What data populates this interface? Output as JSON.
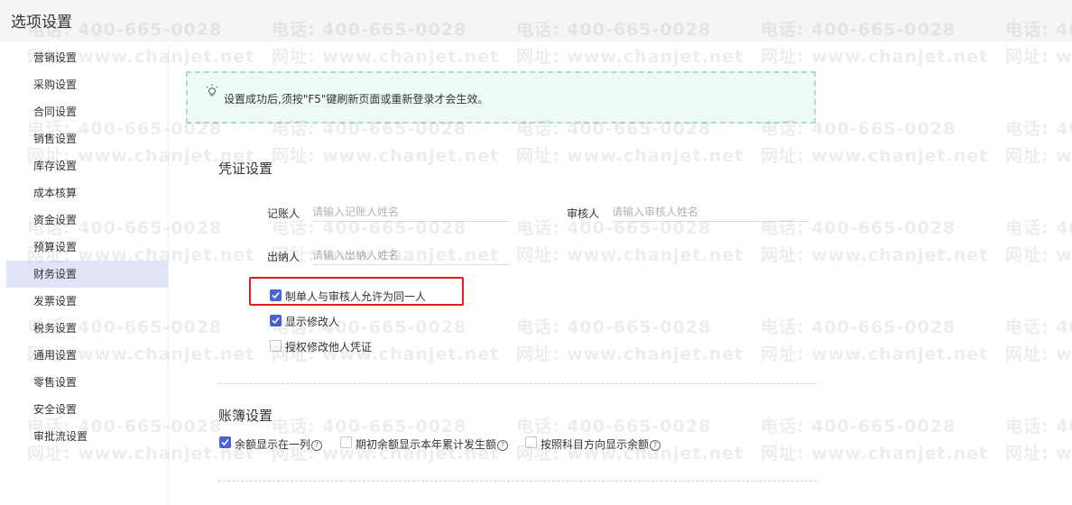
{
  "window": {
    "title": "选项设置"
  },
  "sidebar": {
    "items": [
      {
        "label": "营销设置"
      },
      {
        "label": "采购设置"
      },
      {
        "label": "合同设置"
      },
      {
        "label": "销售设置"
      },
      {
        "label": "库存设置"
      },
      {
        "label": "成本核算"
      },
      {
        "label": "资金设置"
      },
      {
        "label": "预算设置"
      },
      {
        "label": "财务设置",
        "active": true
      },
      {
        "label": "发票设置"
      },
      {
        "label": "税务设置"
      },
      {
        "label": "通用设置"
      },
      {
        "label": "零售设置"
      },
      {
        "label": "安全设置"
      },
      {
        "label": "审批流设置"
      }
    ]
  },
  "notice": {
    "text": "设置成功后,须按\"F5\"键刷新页面或重新登录才会生效。",
    "icon": "lightbulb-icon"
  },
  "voucher": {
    "title": "凭证设置",
    "bookkeeper": {
      "label": "记账人",
      "placeholder": "请输入记账人姓名",
      "value": ""
    },
    "auditor": {
      "label": "审核人",
      "placeholder": "请输入审核人姓名",
      "value": ""
    },
    "cashier": {
      "label": "出纳人",
      "placeholder": "请输入出纳人姓名",
      "value": ""
    },
    "options": [
      {
        "label": "制单人与审核人允许为同一人",
        "checked": true
      },
      {
        "label": "显示修改人",
        "checked": true
      },
      {
        "label": "授权修改他人凭证",
        "checked": false
      }
    ]
  },
  "ledger": {
    "title": "账簿设置",
    "options": [
      {
        "label": "余额显示在一列",
        "checked": true
      },
      {
        "label": "期初余额显示本年累计发生额",
        "checked": false
      },
      {
        "label": "按照科目方向显示余额",
        "checked": false
      }
    ],
    "help_glyph": "?"
  },
  "watermark": {
    "phone": "电话: 400-665-0028",
    "site": "网址: www.chanjet.net"
  },
  "colors": {
    "accent": "#4b62d8",
    "highlight": "#e02020",
    "notice_bg": "#eefbf4",
    "active_bg": "#e1e3f7"
  }
}
